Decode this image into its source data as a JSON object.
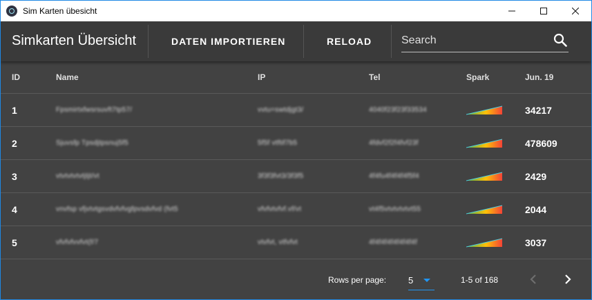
{
  "window": {
    "title": "Sim Karten übesicht"
  },
  "toolbar": {
    "title": "Simkarten Übersicht",
    "import_label": "DATEN IMPORTIEREN",
    "reload_label": "RELOAD",
    "search_placeholder": "Search"
  },
  "table": {
    "headers": {
      "id": "ID",
      "name": "Name",
      "ip": "IP",
      "tel": "Tel",
      "spark": "Spark",
      "jun": "Jun. 19"
    },
    "rows": [
      {
        "id": "1",
        "name": "Fpsmirtxfwsrsuvft7tp57/",
        "ip": "vvtu=swtdjgt3/",
        "tel": "4040f23f23f33534",
        "jun": "34217"
      },
      {
        "id": "2",
        "name": "Sjuvsfp Tpsdjtpsnuj5f5",
        "ip": "5f5f vtftif7b5",
        "tel": "4fdvf2f2f4fvf23f",
        "jun": "478609"
      },
      {
        "id": "3",
        "name": "vtvtvtvtvtjtjt/vt",
        "ip": "3f3f3fvt3/3f3f5",
        "tel": "4f4fu4f4f4f4f5f4",
        "jun": "2429"
      },
      {
        "id": "4",
        "name": "vnvfsp vfjvtvtgsvdvfvfvgfpvsdvfvd (fvt5",
        "ip": "vfvfvtvfvf.vf/vt",
        "tel": "vt4f5vtvtvtvtvt55",
        "jun": "2044"
      },
      {
        "id": "5",
        "name": "vfvfvfvvfvt(f/7",
        "ip": "vtvfvt, vtfvfvt",
        "tel": "4f4f4f4f4f4f4f4f",
        "jun": "3037"
      }
    ]
  },
  "footer": {
    "rows_per_page_label": "Rows per page:",
    "rows_per_page_value": "5",
    "range_text": "1-5 of 168"
  },
  "colors": {
    "window_bg": "#424242",
    "toolbar_bg": "#3a3a3a",
    "accent": "#2196f3",
    "spark_green": "#4caf50",
    "spark_yellow": "#ffc107",
    "spark_red": "#f44336"
  },
  "icons": {
    "app": "electron-icon",
    "search": "search-icon",
    "minimize": "minimize-icon",
    "maximize": "maximize-icon",
    "close": "close-icon",
    "dropdown": "dropdown-arrow-icon",
    "prev": "chevron-left-icon",
    "next": "chevron-right-icon"
  }
}
